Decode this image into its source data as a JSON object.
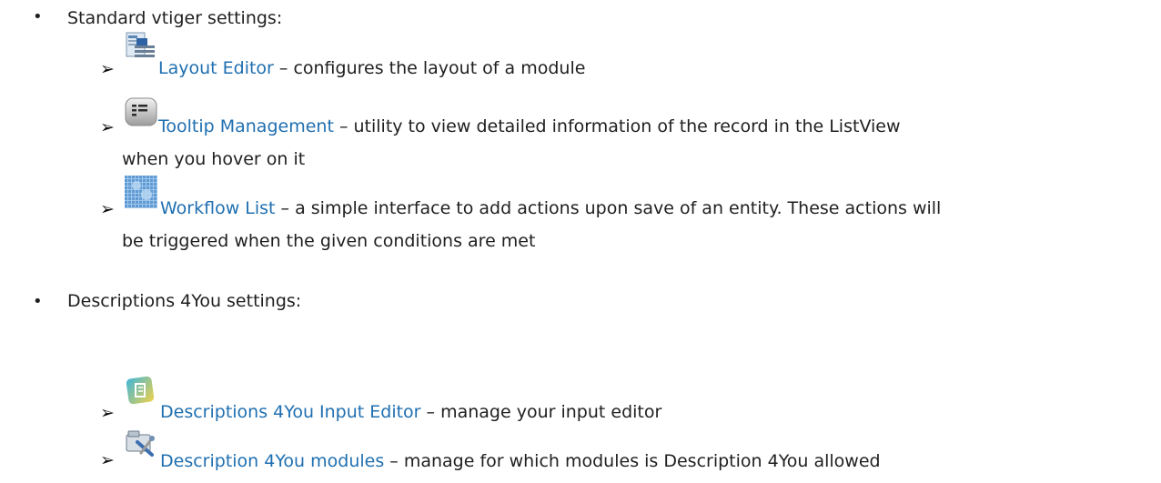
{
  "section1": {
    "heading": "Standard vtiger settings:",
    "items": [
      {
        "icon": "layout-editor-icon",
        "link": "Layout Editor",
        "rest": " – configures the layout of a module",
        "cont": ""
      },
      {
        "icon": "tooltip-management-icon",
        "link": "Tooltip Management",
        "rest": " – utility to view detailed information of the record in the ListView",
        "cont": "when you hover on it"
      },
      {
        "icon": "workflow-list-icon",
        "link": "Workflow List",
        "rest": " – a simple interface to add actions upon save of an entity. These actions will",
        "cont": "be triggered when the given conditions are met"
      }
    ]
  },
  "section2": {
    "heading": "Descriptions 4You settings:",
    "items": [
      {
        "icon": "descriptions-input-editor-icon",
        "link": "Descriptions 4You Input Editor",
        "rest": " – manage your input editor",
        "cont": ""
      },
      {
        "icon": "description-modules-icon",
        "link": "Description 4You modules",
        "rest": " – manage for which modules is Description 4You allowed",
        "cont": ""
      }
    ]
  }
}
